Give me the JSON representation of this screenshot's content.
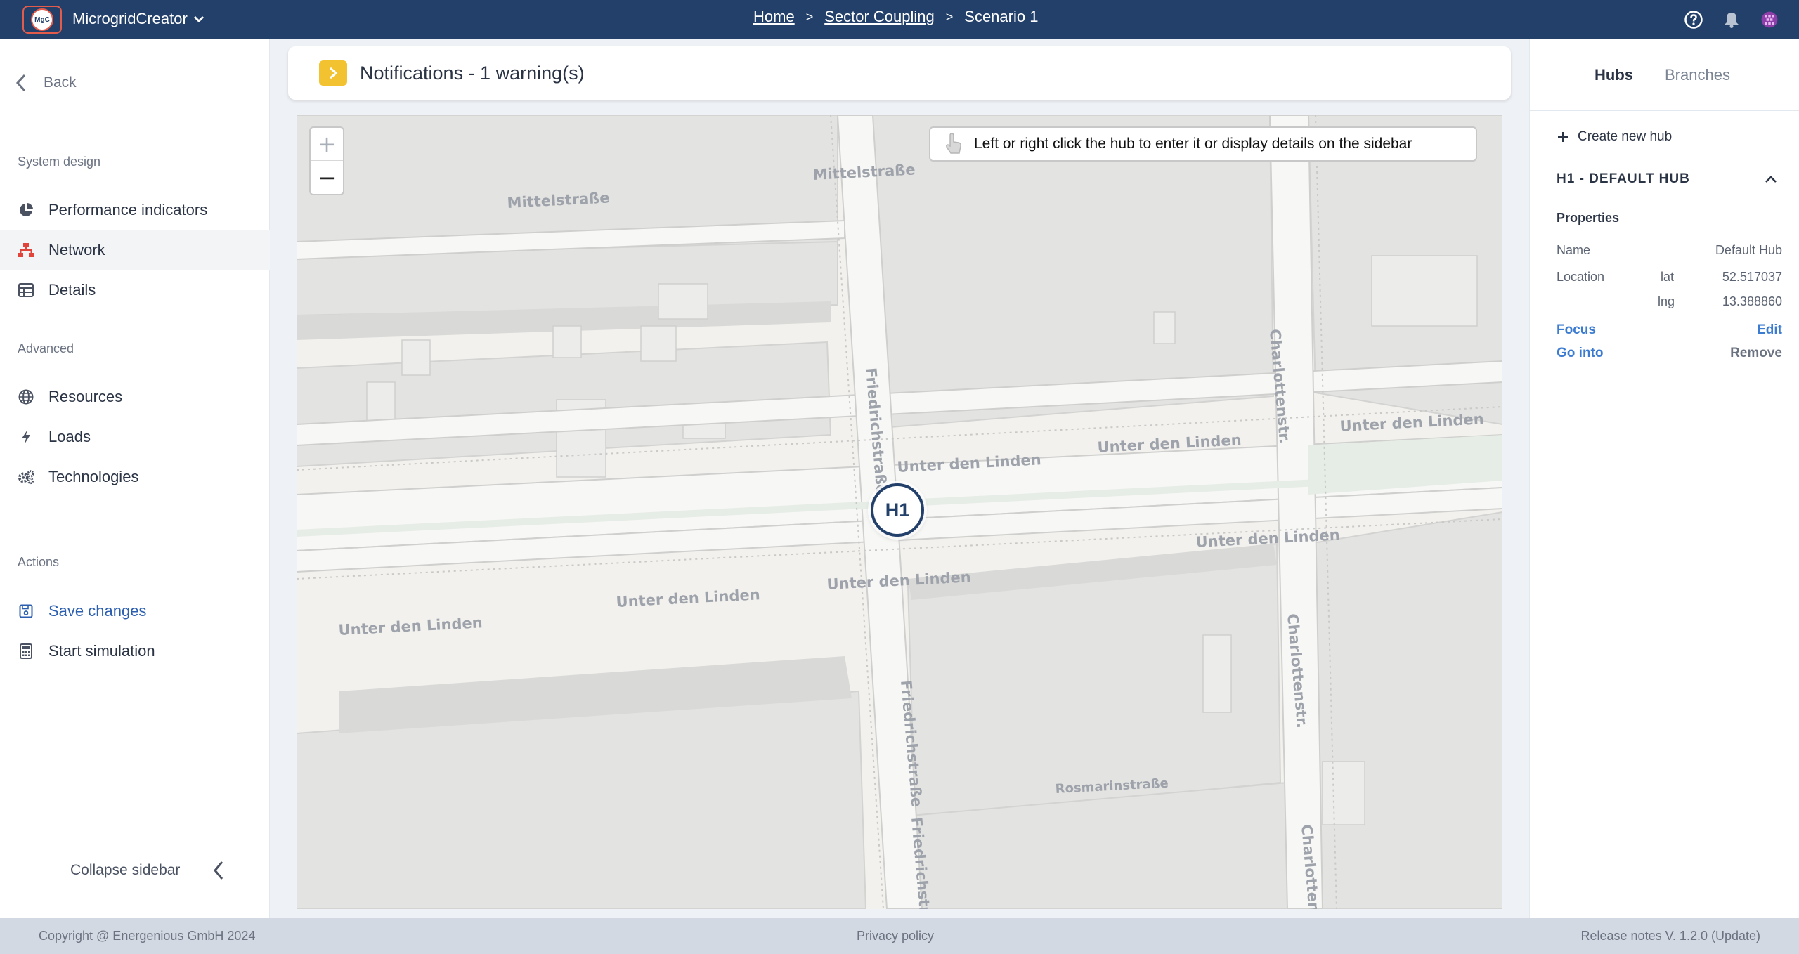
{
  "header": {
    "logo_text": "MgC",
    "app_name": "MicrogridCreator",
    "breadcrumb": [
      "Home",
      "Sector Coupling",
      "Scenario 1"
    ],
    "separator": ">"
  },
  "sidebar": {
    "back_label": "Back",
    "sections": {
      "system_design": "System design",
      "advanced": "Advanced",
      "actions": "Actions"
    },
    "items": [
      {
        "label": "Performance indicators",
        "icon": "pie-chart-icon"
      },
      {
        "label": "Network",
        "icon": "network-icon",
        "active": true
      },
      {
        "label": "Details",
        "icon": "table-icon"
      },
      {
        "label": "Resources",
        "icon": "globe-icon"
      },
      {
        "label": "Loads",
        "icon": "bolt-icon"
      },
      {
        "label": "Technologies",
        "icon": "gears-icon"
      }
    ],
    "actions": [
      {
        "label": "Save changes",
        "icon": "save-icon"
      },
      {
        "label": "Start simulation",
        "icon": "calculator-icon"
      }
    ],
    "collapse_label": "Collapse sidebar"
  },
  "notifications": {
    "title": "Notifications - 1 warning(s)"
  },
  "map": {
    "hint": "Left or right click the hub to enter it or display details on the sidebar",
    "zoom_in": "+",
    "zoom_out": "−",
    "hub_label": "H1",
    "streets": {
      "mittelstrasse": "Mittelstraße",
      "friedrichstrasse": "Friedrichstraße",
      "unter_den_linden": "Unter den Linden",
      "charlottenstr_short": "Charlottenstr.",
      "charlottenstr": "Charlottenstr.",
      "rosmarinstrasse": "Rosmarinstraße"
    }
  },
  "right_panel": {
    "tabs": [
      "Hubs",
      "Branches"
    ],
    "create_label": "Create new hub",
    "hub_title": "H1 - DEFAULT HUB",
    "properties_label": "Properties",
    "name_key": "Name",
    "name_value": "Default Hub",
    "location_key": "Location",
    "lat_key": "lat",
    "lat_value": "52.517037",
    "lng_key": "lng",
    "lng_value": "13.388860",
    "focus": "Focus",
    "edit": "Edit",
    "go_into": "Go into",
    "remove": "Remove"
  },
  "footer": {
    "copyright": "Copyright @ Energenious GmbH 2024",
    "privacy": "Privacy policy",
    "release": "Release notes V. 1.2.0 (Update)"
  },
  "colors": {
    "header_bg": "#23406b",
    "accent_blue": "#2c5fb0",
    "active_icon": "#e0443a",
    "warning": "#f2c230"
  }
}
